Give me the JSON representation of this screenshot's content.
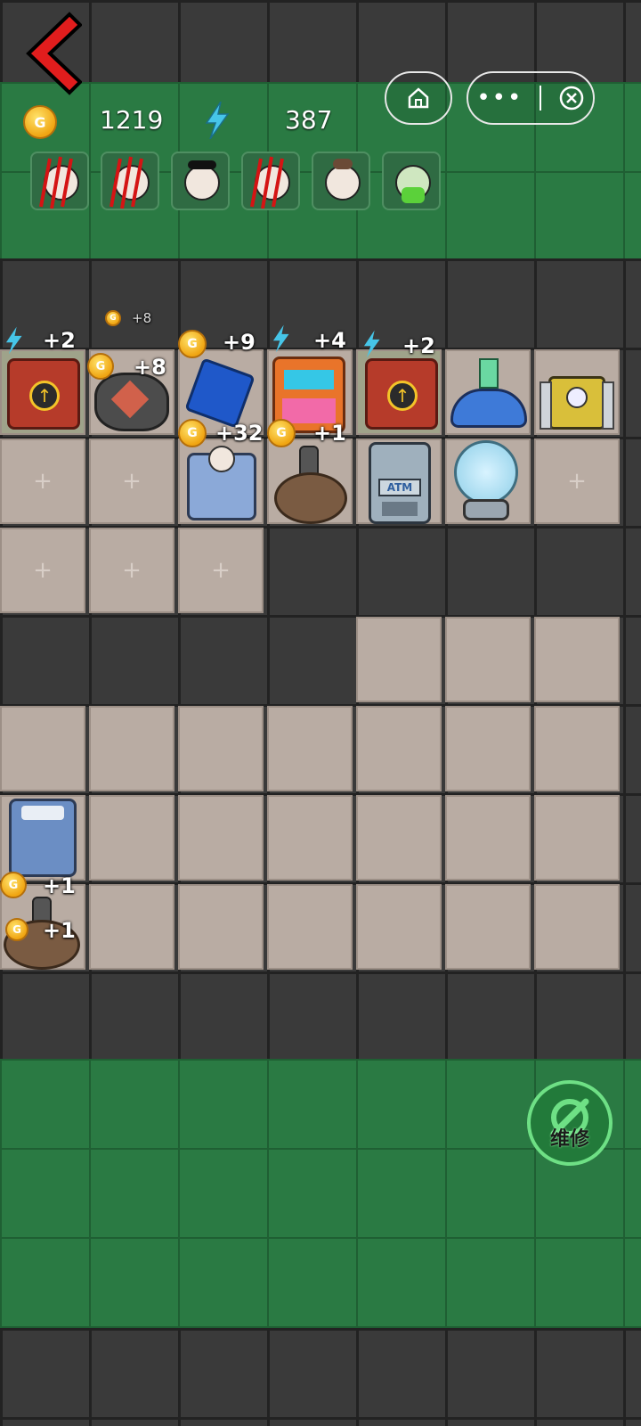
{
  "resources": {
    "gold": "1219",
    "energy": "387"
  },
  "window_controls": [
    "home-icon",
    "more-icon",
    "close-icon"
  ],
  "character_slots": [
    {
      "state": "scratched"
    },
    {
      "state": "scratched"
    },
    {
      "state": "alive"
    },
    {
      "state": "scratched"
    },
    {
      "state": "alive"
    },
    {
      "state": "sick"
    }
  ],
  "floating_gains": {
    "row1": [
      "+2",
      "+8",
      "+9",
      "+4",
      "+2"
    ],
    "row1_small": "+8",
    "row2": [
      "+32",
      "+1"
    ],
    "bed_row": "+1",
    "bed_row2": "+1"
  },
  "item_labels": {
    "atm": "ATM"
  },
  "repair_button": {
    "label": "维修"
  },
  "colors": {
    "grass": "#2a7a43",
    "wall": "#3a3a3a",
    "floor": "#b9aca3",
    "gold": "#f0a512",
    "energy": "#46c5e8"
  }
}
